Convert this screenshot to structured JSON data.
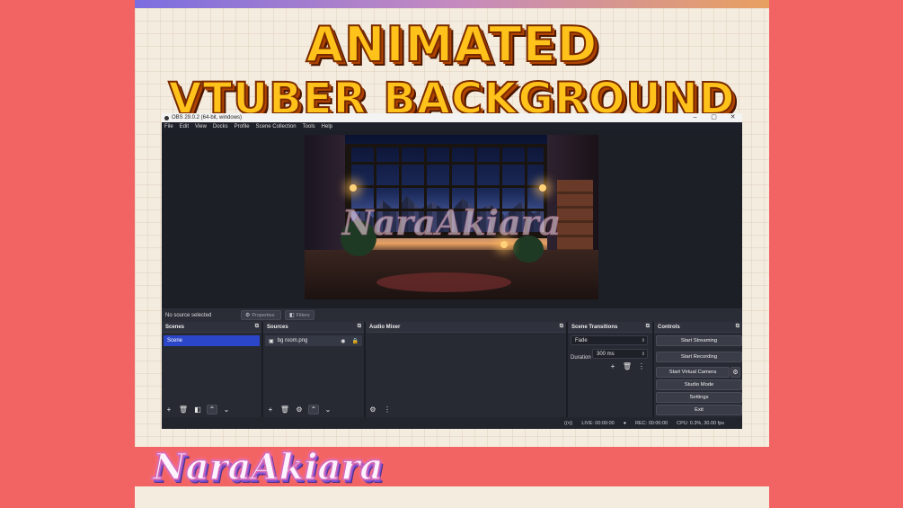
{
  "banner": {
    "title_line1": "ANIMATED",
    "title_line2": "VTUBER BACKGROUND",
    "brand_signature": "NaraAkiara"
  },
  "colors": {
    "page_background": "#f26464",
    "paper": "#f4ecde",
    "title_fill": "#ffc21a",
    "title_outline": "#7a2a00",
    "obs_panel": "#272a33",
    "selected_scene": "#2b46c8"
  },
  "window": {
    "title": "OBS 29.0.2 (64-bit, windows)",
    "minimize": "–",
    "maximize": "▢",
    "close": "✕"
  },
  "menu": [
    "File",
    "Edit",
    "View",
    "Docks",
    "Profile",
    "Scene Collection",
    "Tools",
    "Help"
  ],
  "preview": {
    "watermark": "NaraAkiara"
  },
  "source_status": {
    "no_source_text": "No source selected",
    "properties_label": "Properties",
    "filters_label": "Filters"
  },
  "scenes": {
    "title": "Scenes",
    "items": [
      "Scene"
    ]
  },
  "sources": {
    "title": "Sources",
    "items": [
      {
        "name": "bg room.png",
        "icon": "image-icon"
      }
    ]
  },
  "audio_mixer": {
    "title": "Audio Mixer"
  },
  "transitions": {
    "title": "Scene Transitions",
    "selected": "Fade",
    "duration_label": "Duration",
    "duration_value": "300 ms"
  },
  "controls": {
    "title": "Controls",
    "start_streaming": "Start Streaming",
    "start_recording": "Start Recording",
    "start_virtual_camera": "Start Virtual Camera",
    "studio_mode": "Studio Mode",
    "settings": "Settings",
    "exit": "Exit"
  },
  "status_bar": {
    "live": "LIVE: 00:00:00",
    "rec": "REC: 00:00:00",
    "cpu": "CPU: 0.3%, 30.00 fps"
  }
}
